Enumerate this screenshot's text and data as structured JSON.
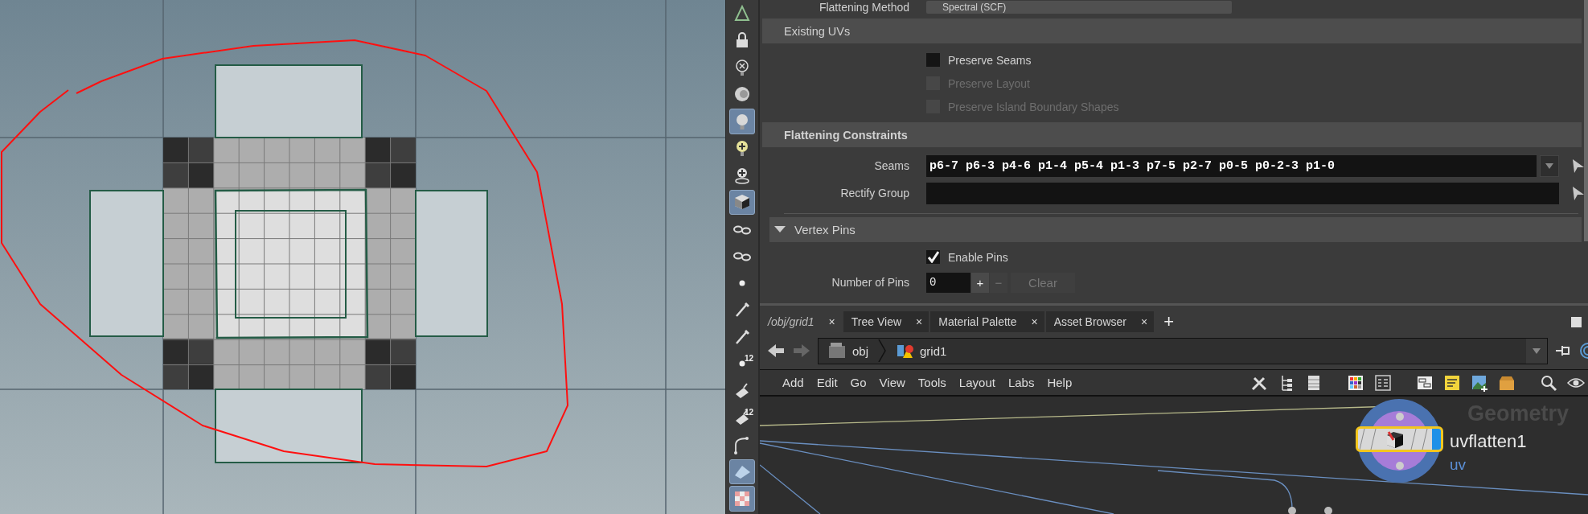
{
  "shelf": [
    {
      "kind": "cone",
      "selected": false
    },
    {
      "kind": "lock",
      "selected": false
    },
    {
      "kind": "light-off",
      "selected": false
    },
    {
      "kind": "sphere",
      "selected": false
    },
    {
      "kind": "light",
      "selected": true
    },
    {
      "kind": "light-plus",
      "selected": false
    },
    {
      "kind": "light-skull",
      "selected": false
    },
    {
      "kind": "cube",
      "selected": true
    },
    {
      "kind": "glasses",
      "selected": false
    },
    {
      "kind": "glasses",
      "selected": false
    },
    {
      "kind": "dot",
      "selected": false
    },
    {
      "kind": "pen",
      "selected": false
    },
    {
      "kind": "pen",
      "selected": false
    },
    {
      "kind": "points",
      "selected": false,
      "badge": "12"
    },
    {
      "kind": "brush",
      "selected": false
    },
    {
      "kind": "brush",
      "selected": false,
      "badge": "12"
    },
    {
      "kind": "curve",
      "selected": false
    },
    {
      "kind": "plane",
      "selected": true
    },
    {
      "kind": "checker",
      "selected": true
    }
  ],
  "parameters": [
    {
      "kind": "menu",
      "label": "Flattening Method",
      "value": "Spectral (SCF)"
    },
    {
      "kind": "section",
      "label": "Existing UVs",
      "bold": false
    },
    {
      "kind": "checkbox",
      "label": "Preserve Seams",
      "checked": false,
      "disabled": false
    },
    {
      "kind": "checkbox",
      "label": "Preserve Layout",
      "checked": false,
      "disabled": true
    },
    {
      "kind": "checkbox",
      "label": "Preserve Island Boundary Shapes",
      "checked": false,
      "disabled": true
    },
    {
      "kind": "section",
      "label": "Flattening Constraints",
      "bold": true
    },
    {
      "kind": "group",
      "label": "Seams",
      "value": "p6-7 p6-3 p4-6 p1-4 p5-4 p1-3 p7-5 p2-7 p0-5 p0-2-3 p1-0",
      "dropdown": true
    },
    {
      "kind": "group",
      "label": "Rectify Group",
      "dropdown": false
    },
    {
      "kind": "folder",
      "label": "Vertex Pins",
      "expanded": true
    },
    {
      "kind": "checkbox",
      "label": "Enable Pins",
      "checked": true,
      "disabled": false
    },
    {
      "kind": "counter",
      "label": "Number of Pins",
      "value": "0",
      "buttons": [
        {
          "label": "+",
          "disabled": false
        },
        {
          "label": "−",
          "disabled": true
        },
        {
          "label": "Clear",
          "disabled": true
        }
      ]
    }
  ],
  "network": {
    "tabs": [
      {
        "label": "/obj/grid1",
        "selected": true,
        "close": "×"
      },
      {
        "label": "Tree View",
        "selected": false,
        "close": "×"
      },
      {
        "label": "Material Palette",
        "selected": false,
        "close": "×"
      },
      {
        "label": "Asset Browser",
        "selected": false,
        "close": "×"
      }
    ],
    "new_tab": "+",
    "path": [
      {
        "label": "obj",
        "kind": "folder"
      },
      {
        "label": "grid1",
        "kind": "geometry"
      }
    ],
    "menu": [
      "Add",
      "Edit",
      "Go",
      "View",
      "Tools",
      "Layout",
      "Labs",
      "Help"
    ],
    "context_label": "Geometry",
    "node": {
      "name": "uvflatten1",
      "type": "uv",
      "selected": true
    }
  }
}
